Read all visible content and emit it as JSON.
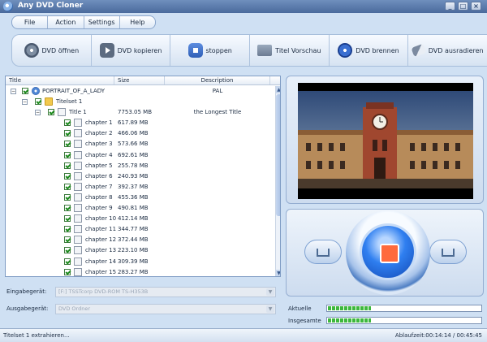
{
  "window": {
    "title": "Any DVD Cloner",
    "app_icon": "disc-icon",
    "buttons": [
      "_",
      "□",
      "×"
    ]
  },
  "menu": [
    "File",
    "Action",
    "Settings",
    "Help"
  ],
  "toolbar": [
    {
      "label": "DVD öffnen",
      "icon": "open-disc-icon"
    },
    {
      "label": "DVD kopieren",
      "icon": "copy-play-icon"
    },
    {
      "label": "stoppen",
      "icon": "stop-icon"
    },
    {
      "label": "Titel Vorschau",
      "icon": "preview-monitor-icon"
    },
    {
      "label": "DVD brennen",
      "icon": "burn-disc-icon"
    },
    {
      "label": "DVD ausradieren",
      "icon": "eraser-icon"
    }
  ],
  "tree": {
    "columns": [
      "Title",
      "Size",
      "Description"
    ],
    "root": {
      "title": "PORTRAIT_OF_A_LADY",
      "size": "",
      "description": "PAL"
    },
    "titleset": {
      "title": "Titelset 1"
    },
    "title": {
      "title": "Title 1",
      "size": "7753.05 MB",
      "description": "the Longest Title"
    },
    "chapters": [
      {
        "title": "chapter 1",
        "size": "617.89 MB"
      },
      {
        "title": "chapter 2",
        "size": "466.06 MB"
      },
      {
        "title": "chapter 3",
        "size": "573.66 MB"
      },
      {
        "title": "chapter 4",
        "size": "692.61 MB"
      },
      {
        "title": "chapter 5",
        "size": "255.78 MB"
      },
      {
        "title": "chapter 6",
        "size": "240.93 MB"
      },
      {
        "title": "chapter 7",
        "size": "392.37 MB"
      },
      {
        "title": "chapter 8",
        "size": "455.36 MB"
      },
      {
        "title": "chapter 9",
        "size": "490.81 MB"
      },
      {
        "title": "chapter 10",
        "size": "412.14 MB"
      },
      {
        "title": "chapter 11",
        "size": "344.77 MB"
      },
      {
        "title": "chapter 12",
        "size": "372.44 MB"
      },
      {
        "title": "chapter 13",
        "size": "223.10 MB"
      },
      {
        "title": "chapter 14",
        "size": "309.39 MB"
      },
      {
        "title": "chapter 15",
        "size": "283.27 MB"
      }
    ]
  },
  "input_device": {
    "label": "Eingabegerät:",
    "value": "[F:] TSSTcorp DVD-ROM TS-H353B"
  },
  "output_device": {
    "label": "Ausgabegerät:",
    "value": "DVD Ordner"
  },
  "progress": {
    "current_label": "Aktuelle",
    "total_label": "Insgesamte",
    "current_fraction": 0.28,
    "total_fraction": 0.28
  },
  "status": {
    "message": "Titelset 1 extrahieren...",
    "elapsed": "Ablaufzeit:00:14:14 / 00:45:45"
  }
}
